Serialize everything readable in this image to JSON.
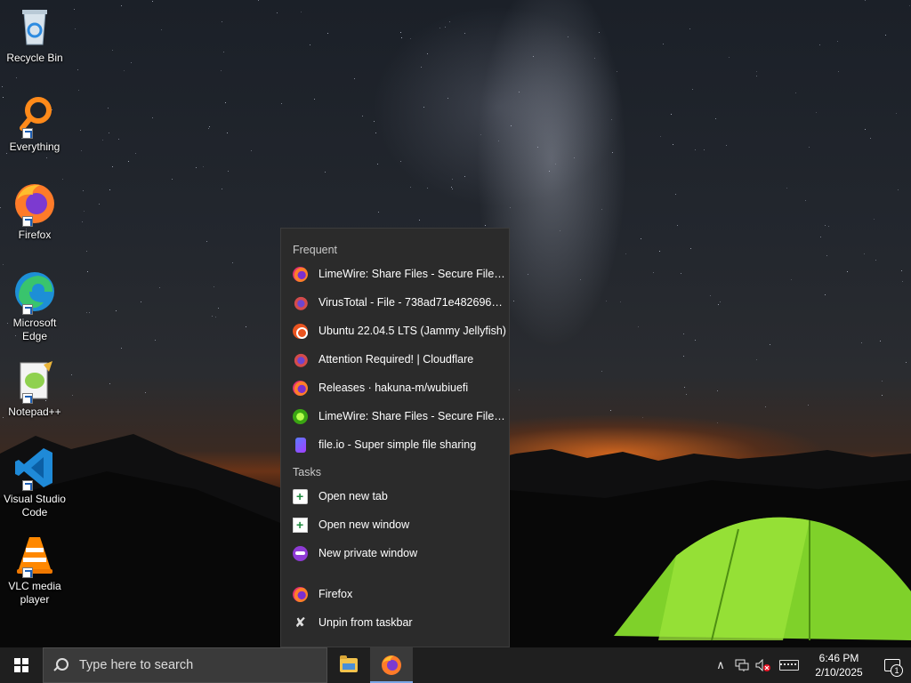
{
  "desktop": {
    "icons": [
      {
        "label": "Recycle Bin",
        "icon": "recycle-bin-icon"
      },
      {
        "label": "Everything",
        "icon": "everything-search-icon"
      },
      {
        "label": "Firefox",
        "icon": "firefox-icon"
      },
      {
        "label": "Microsoft Edge",
        "icon": "edge-icon"
      },
      {
        "label": "Notepad++",
        "icon": "notepadpp-icon"
      },
      {
        "label": "Visual Studio Code",
        "icon": "vscode-icon"
      },
      {
        "label": "VLC media player",
        "icon": "vlc-icon"
      }
    ]
  },
  "jumplist": {
    "frequent_header": "Frequent",
    "frequent": [
      {
        "label": "LimeWire: Share Files - Secure File Upl...",
        "icon": "firefox-icon"
      },
      {
        "label": "VirusTotal - File - 738ad71e4826961fb...",
        "icon": "virustotal-icon"
      },
      {
        "label": "Ubuntu 22.04.5 LTS (Jammy Jellyfish)",
        "icon": "ubuntu-icon"
      },
      {
        "label": "Attention Required! | Cloudflare",
        "icon": "virustotal-icon"
      },
      {
        "label": "Releases · hakuna-m/wubiuefi",
        "icon": "firefox-icon"
      },
      {
        "label": "LimeWire: Share Files - Secure File Upl...",
        "icon": "limewire-icon"
      },
      {
        "label": "file.io - Super simple file sharing",
        "icon": "fileio-icon"
      }
    ],
    "tasks_header": "Tasks",
    "tasks": [
      {
        "label": "Open new tab",
        "icon": "new-tab-icon"
      },
      {
        "label": "Open new window",
        "icon": "new-window-icon"
      },
      {
        "label": "New private window",
        "icon": "private-window-icon"
      }
    ],
    "app": {
      "label": "Firefox",
      "icon": "firefox-icon"
    },
    "unpin": {
      "label": "Unpin from taskbar",
      "icon": "unpin-icon"
    }
  },
  "taskbar": {
    "search_placeholder": "Type here to search",
    "clock_time": "6:46 PM",
    "clock_date": "2/10/2025",
    "notification_count": "1"
  }
}
